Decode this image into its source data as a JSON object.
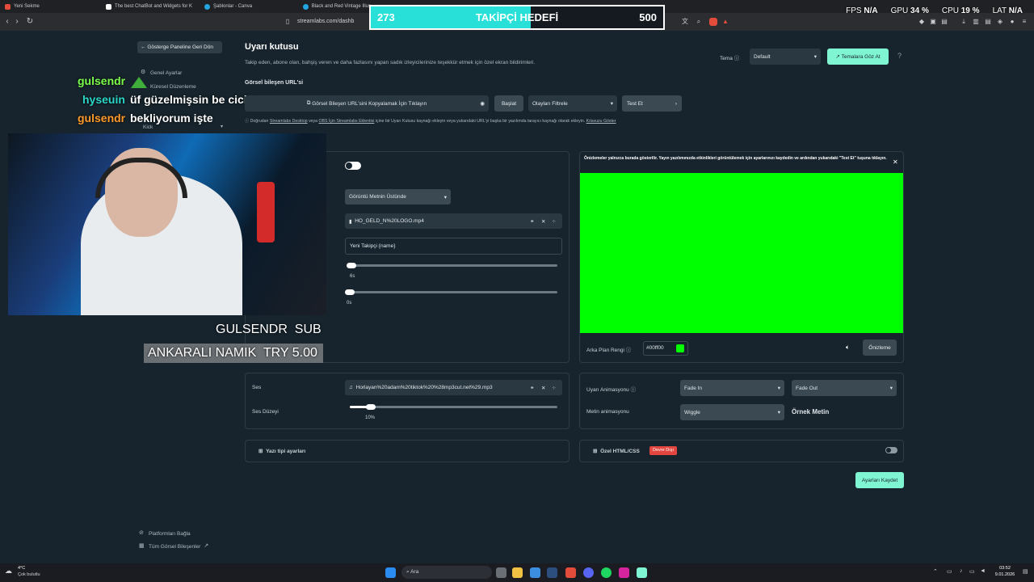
{
  "browser": {
    "tabs": [
      "Yeni Sekme",
      "The best ChatBot and Widgets for K",
      "Şablonlar - Canva",
      "Black and Red Vintage Illus"
    ],
    "url": "streamlabs.com/dashb"
  },
  "stats": {
    "fps_label": "FPS",
    "fps": "N/A",
    "gpu_label": "GPU",
    "gpu": "34",
    "gpu_unit": "%",
    "cpu_label": "CPU",
    "cpu": "19",
    "cpu_unit": "%",
    "lat_label": "LAT",
    "lat": "N/A"
  },
  "follow_goal": {
    "current": "273",
    "title": "TAKİPÇİ HEDEFİ",
    "target": "500",
    "progress": 0.546
  },
  "sidebar": {
    "back": "Gösterge Paneline Geri Dön",
    "items": [
      "Genel Ayarlar",
      "Küresel Düzenleme"
    ],
    "kick": "Kick",
    "bottom": [
      "Platformları Bağla",
      "Tüm Görsel Bileşenler"
    ]
  },
  "chat": [
    {
      "user": "gulsendr",
      "color": "#7cfc4a",
      "message": ""
    },
    {
      "user": "hyseuin",
      "color": "#29d7c8",
      "message": "üf güzelmişsin be cicim"
    },
    {
      "user": "gulsendr",
      "color": "#ff9a2a",
      "message": "bekliyorum işte"
    }
  ],
  "overlay": {
    "sub_user": "GULSENDR",
    "sub_label": "SUB",
    "tip_user": "ANKARALI NAMIK",
    "tip_amount": "TRY 5.00"
  },
  "header": {
    "title": "Uyarı kutusu",
    "description": "Takip eden, abone olan, bahşiş veren ve daha fazlasını yapan sadık izleyicilerinize teşekkür etmek için özel ekran bildirimleri.",
    "theme_label": "Tema",
    "theme_value": "Default",
    "browse_themes": "Temalara Göz At"
  },
  "widget_url": {
    "label": "Görsel bileşen URL'si",
    "copy_text": "Görsel Bileşen URL'sini Kopyalamak İçin Tıklayın",
    "start": "Başlat",
    "filter": "Olayları Filtrele",
    "test": "Test Et",
    "hint_prefix": "Doğrudan",
    "hint_link1": "Streamlabs Desktop",
    "hint_mid": "veya",
    "hint_link2": "OBS İçin Streamlabs Eklentisi",
    "hint_suffix": "içine bir Uyarı Kutusu kaynağı ekleyin veya yukarıdaki URL'yi başka bir yazılımda tarayıcı kaynağı olarak ekleyin.",
    "hint_link3": "Kılavuzu Göster"
  },
  "alert_settings": {
    "layout_value": "Görüntü Metnin Üstünde",
    "media_file": "HO_GELD_N%20LOGO.mp4",
    "message_template": "Yeni Takipçi {name}",
    "duration_value": "6s",
    "delay_value": "0s",
    "duration_level": 0.0,
    "delay_level": 0.0
  },
  "preview": {
    "note": "Önizlemeler yalnızca burada gösterilir. Yayın yazılımınızda etkinlikleri görüntülemek için ayarlarınızı kaydedin ve ardından yukarıdaki \"Test Et\" tuşuna tıklayın.",
    "bg_label": "Arka Plan Rengi",
    "bg_value": "#00ff00",
    "bg_color": "#00ff00",
    "preview_button": "Önizleme"
  },
  "sound": {
    "label": "Ses",
    "file": "Horlayan%20adam%20tiktok%20%28mp3cut.net%29.mp3",
    "volume_label": "Ses Düzeyi",
    "volume_value": "10%",
    "volume_level": 0.1
  },
  "animation": {
    "alert_label": "Uyarı Animasyonu",
    "in_value": "Fade In",
    "out_value": "Fade Out",
    "text_label": "Metin animasyonu",
    "text_value": "Wiggle",
    "sample_text": "Örnek Metin"
  },
  "font_settings": {
    "label": "Yazı tipi ayarları"
  },
  "custom_html": {
    "label": "Özel HTML/CSS",
    "badge": "Devre Dışı"
  },
  "save_button": "Ayarları Kaydet",
  "taskbar": {
    "weather_temp": "4°C",
    "weather_desc": "Çok bulutlu",
    "search": "Ara",
    "time": "03:52",
    "date": "9.01.2026"
  },
  "colors": {
    "accent": "#80f5d2",
    "goal_fill": "#29e0d8",
    "badge_red": "#e2463f"
  }
}
